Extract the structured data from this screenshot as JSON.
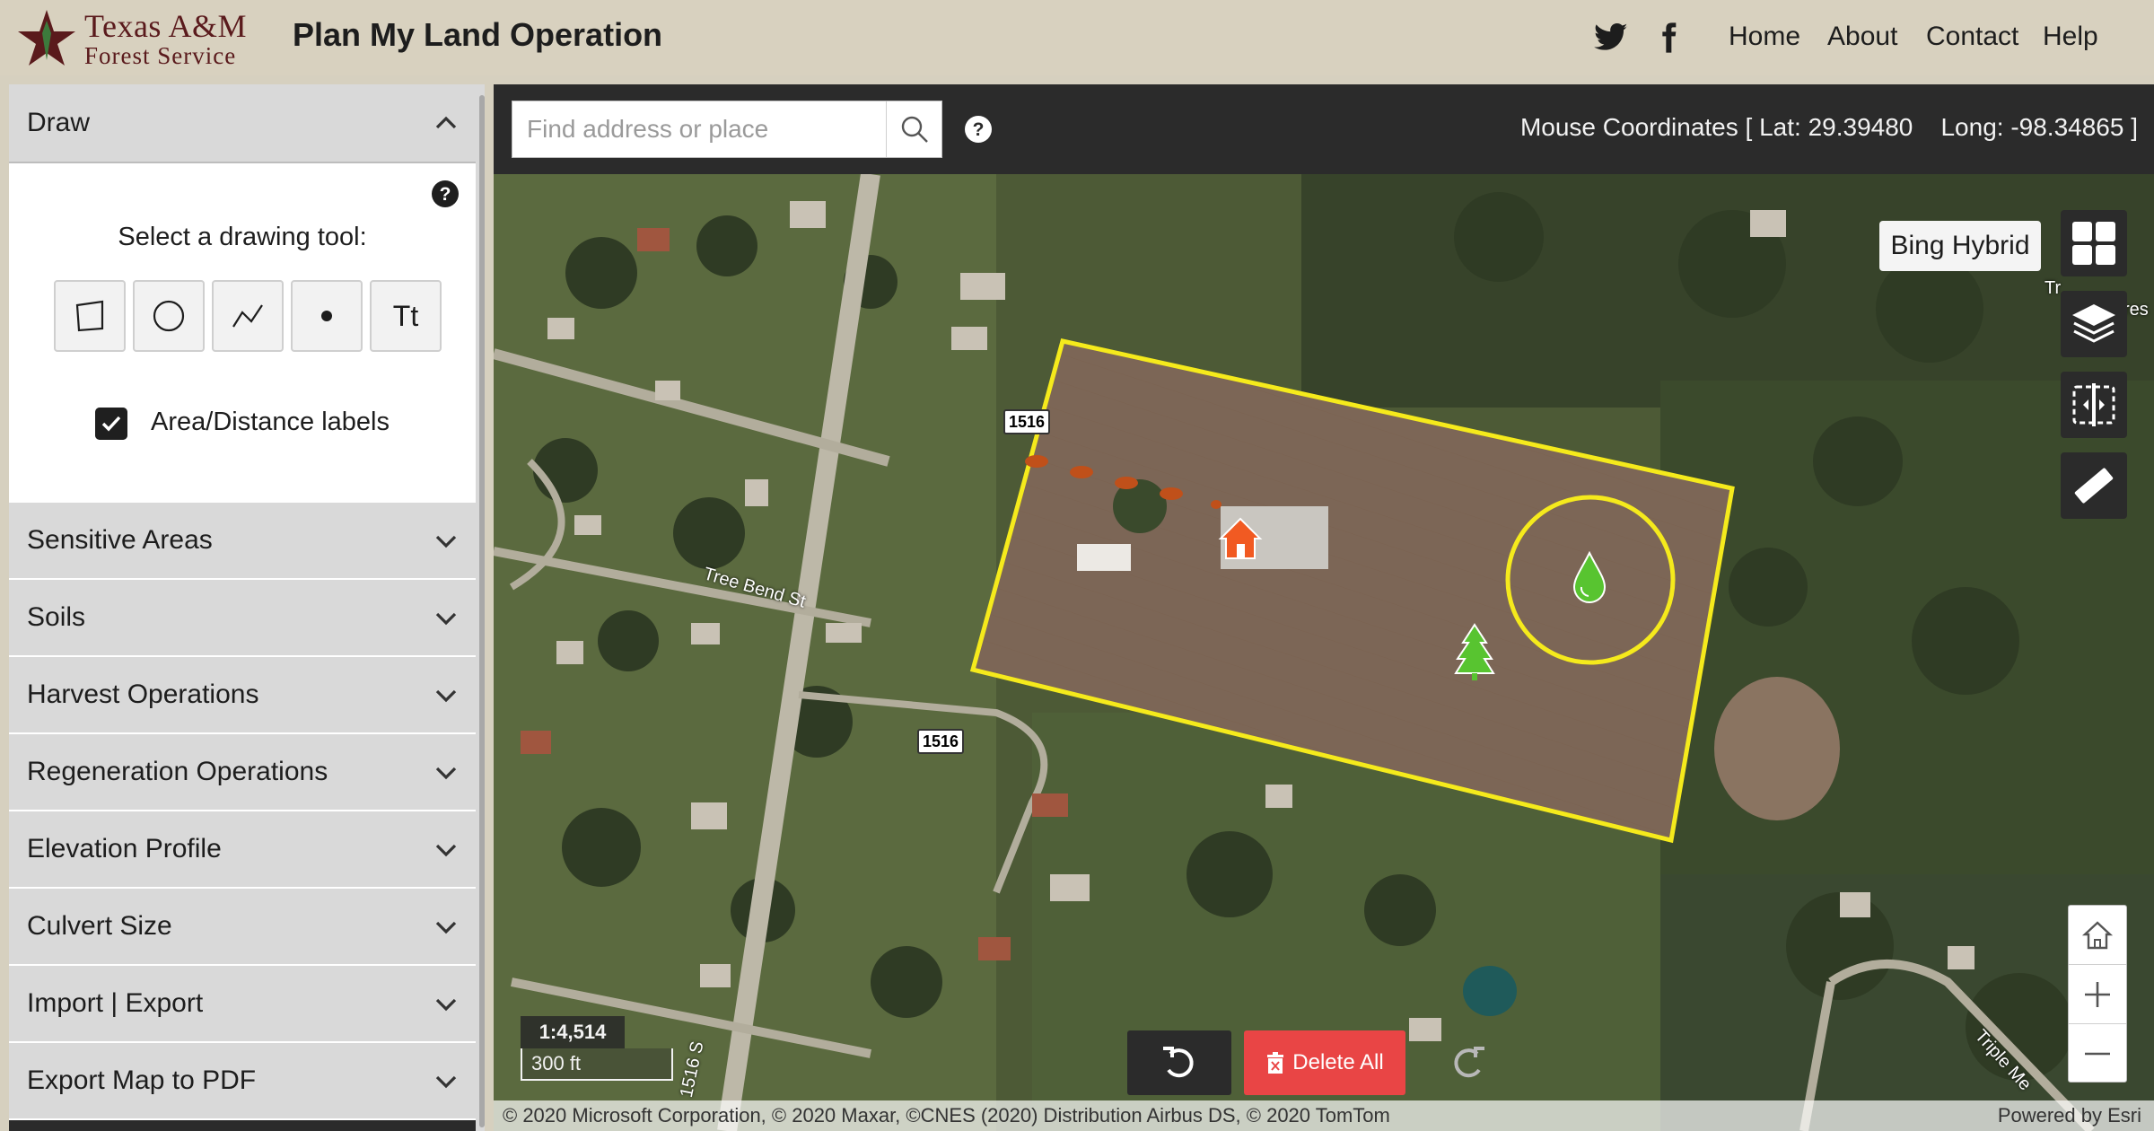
{
  "header": {
    "logo_line1": "Texas A&M",
    "logo_line2": "Forest Service",
    "title": "Plan My Land Operation",
    "nav": [
      "Home",
      "About",
      "Contact",
      "Help"
    ]
  },
  "sidebar": {
    "draw": {
      "label": "Draw",
      "expanded": true,
      "prompt": "Select a drawing tool:",
      "tools": [
        "polygon",
        "circle",
        "polyline",
        "point",
        "text"
      ],
      "text_tool_label": "Tt",
      "labels_checkbox_label": "Area/Distance labels",
      "labels_checked": true
    },
    "sections": [
      "Sensitive Areas",
      "Soils",
      "Harvest Operations",
      "Regeneration Operations",
      "Elevation Profile",
      "Culvert Size",
      "Import | Export",
      "Export Map to PDF"
    ]
  },
  "toolbar": {
    "search_placeholder": "Find address or place",
    "coords_text": "Mouse Coordinates [ Lat: 29.39480    Long: -98.34865 ]"
  },
  "map": {
    "basemap_label": "Bing Hybrid",
    "scale": "1:4,514",
    "scalebar_label": "300 ft",
    "road_shield_1": "1516",
    "road_shield_2": "1516",
    "street_1": "Tree Bend St",
    "street_2": "1516 S",
    "street_3": "Triple Me",
    "street_4": "Tr",
    "street_5": "res",
    "delete_all_label": "Delete All",
    "attribution": "© 2020 Microsoft Corporation, © 2020 Maxar, ©CNES (2020) Distribution Airbus DS, © 2020 TomTom",
    "powered_by": "Powered by Esri",
    "colors": {
      "boundary": "#f5ea1c",
      "house": "#f15a22",
      "tree": "#58c430",
      "water_drop": "#58c430",
      "dashed_line": "#c0501a",
      "delete": "#e94545"
    },
    "icons": [
      "house-icon",
      "tree-icon",
      "water-drop-icon"
    ]
  }
}
